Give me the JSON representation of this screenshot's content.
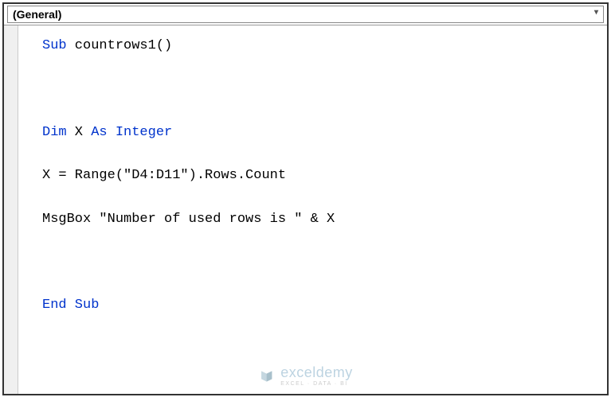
{
  "dropdown": {
    "selected": "(General)"
  },
  "code": {
    "line1_kw": "Sub",
    "line1_txt": " countrows1()",
    "line3_kw1": "Dim",
    "line3_txt1": " X ",
    "line3_kw2": "As Integer",
    "line4_txt": "X = Range(\"D4:D11\").Rows.Count",
    "line5_txt": "MsgBox \"Number of used rows is \" & X",
    "line7_kw": "End Sub"
  },
  "watermark": {
    "name": "exceldemy",
    "tagline": "EXCEL · DATA · BI"
  }
}
